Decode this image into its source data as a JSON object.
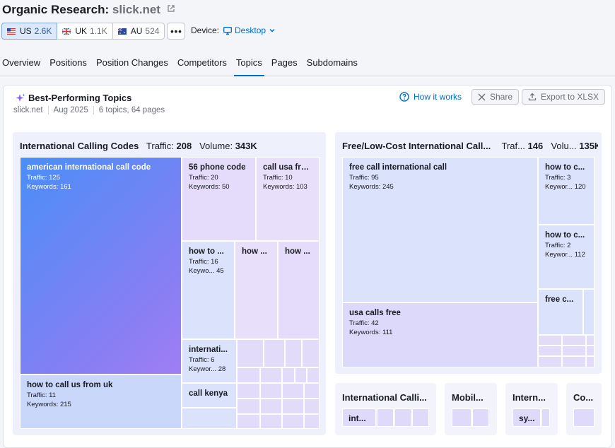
{
  "header": {
    "title": "Organic Research:",
    "domain": "slick.net",
    "databases": [
      {
        "code": "US",
        "count": "2.6K"
      },
      {
        "code": "UK",
        "count": "1.1K"
      },
      {
        "code": "AU",
        "count": "524"
      }
    ],
    "more": "•••",
    "device_label": "Device:",
    "device_value": "Desktop"
  },
  "tabs": [
    "Overview",
    "Positions",
    "Position Changes",
    "Competitors",
    "Topics",
    "Pages",
    "Subdomains"
  ],
  "card": {
    "title": "Best-Performing Topics",
    "meta": [
      "slick.net",
      "Aug 2025",
      "6 topics, 64 pages"
    ],
    "how_it_works": "How it works",
    "share": "Share",
    "export": "Export to XLSX"
  },
  "left_panel": {
    "name": "International Calling Codes",
    "traffic_label": "Traffic:",
    "traffic": "208",
    "volume_label": "Volume:",
    "volume": "343K",
    "tiles": [
      {
        "name": "american international call code",
        "traffic": "Traffic: 125",
        "keywords": "Keywords: 161"
      },
      {
        "name": "56 phone code",
        "traffic": "Traffic: 20",
        "keywords": "Keywords: 50"
      },
      {
        "name": "call usa fro...",
        "traffic": "Traffic: 10",
        "keywords": "Keywords: 103"
      },
      {
        "name": "how to ...",
        "traffic": "Traffic: 16",
        "keywords": "Keywo...  45"
      },
      {
        "name": "how ...",
        "traffic": "",
        "keywords": ""
      },
      {
        "name": "how ...",
        "traffic": "",
        "keywords": ""
      },
      {
        "name": "internati...",
        "traffic": "Traffic: 6",
        "keywords": "Keywor...  28"
      },
      {
        "name": "call kenya",
        "traffic": "",
        "keywords": ""
      },
      {
        "name": "how to call us from uk",
        "traffic": "Traffic: 11",
        "keywords": "Keywords: 215"
      }
    ]
  },
  "right_panel": {
    "name": "Free/Low-Cost International Call...",
    "traffic_label": "Traf...",
    "traffic": "146",
    "volume_label": "Volu...",
    "volume": "135K",
    "tiles": [
      {
        "name": "free call international call",
        "traffic": "Traffic: 95",
        "keywords": "Keywords: 245"
      },
      {
        "name": "how to c...",
        "traffic": "Traffic: 3",
        "keywords": "Keywor...  120"
      },
      {
        "name": "how to c...",
        "traffic": "Traffic: 2",
        "keywords": "Keywor...  112"
      },
      {
        "name": "free c...",
        "traffic": "",
        "keywords": ""
      },
      {
        "name": "usa calls free",
        "traffic": "Traffic: 42",
        "keywords": "Keywords: 111"
      }
    ]
  },
  "mini_panels": [
    {
      "name": "International Calli...",
      "tile": "int..."
    },
    {
      "name": "Mobil...",
      "tile": ""
    },
    {
      "name": "Intern...",
      "tile": "sy..."
    },
    {
      "name": "Co...",
      "tile": ""
    }
  ],
  "colors": {
    "accent": "#006dca",
    "tile_big_start": "#4a8ef7",
    "tile_big_end": "#a07ef5"
  }
}
